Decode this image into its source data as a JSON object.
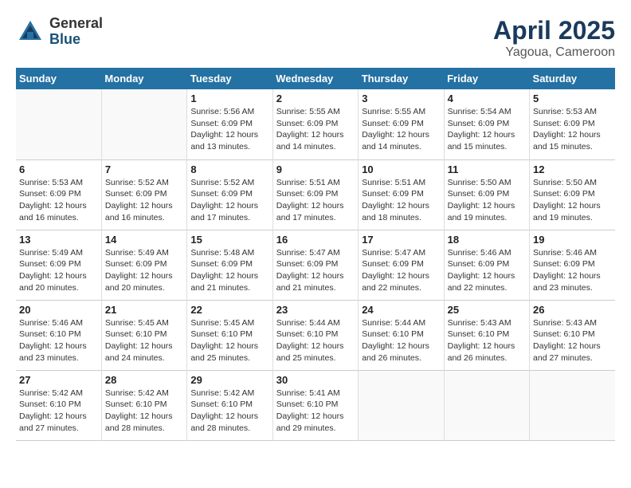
{
  "logo": {
    "general": "General",
    "blue": "Blue"
  },
  "title": "April 2025",
  "subtitle": "Yagoua, Cameroon",
  "header_days": [
    "Sunday",
    "Monday",
    "Tuesday",
    "Wednesday",
    "Thursday",
    "Friday",
    "Saturday"
  ],
  "weeks": [
    [
      {
        "day": "",
        "info": ""
      },
      {
        "day": "",
        "info": ""
      },
      {
        "day": "1",
        "info": "Sunrise: 5:56 AM\nSunset: 6:09 PM\nDaylight: 12 hours\nand 13 minutes."
      },
      {
        "day": "2",
        "info": "Sunrise: 5:55 AM\nSunset: 6:09 PM\nDaylight: 12 hours\nand 14 minutes."
      },
      {
        "day": "3",
        "info": "Sunrise: 5:55 AM\nSunset: 6:09 PM\nDaylight: 12 hours\nand 14 minutes."
      },
      {
        "day": "4",
        "info": "Sunrise: 5:54 AM\nSunset: 6:09 PM\nDaylight: 12 hours\nand 15 minutes."
      },
      {
        "day": "5",
        "info": "Sunrise: 5:53 AM\nSunset: 6:09 PM\nDaylight: 12 hours\nand 15 minutes."
      }
    ],
    [
      {
        "day": "6",
        "info": "Sunrise: 5:53 AM\nSunset: 6:09 PM\nDaylight: 12 hours\nand 16 minutes."
      },
      {
        "day": "7",
        "info": "Sunrise: 5:52 AM\nSunset: 6:09 PM\nDaylight: 12 hours\nand 16 minutes."
      },
      {
        "day": "8",
        "info": "Sunrise: 5:52 AM\nSunset: 6:09 PM\nDaylight: 12 hours\nand 17 minutes."
      },
      {
        "day": "9",
        "info": "Sunrise: 5:51 AM\nSunset: 6:09 PM\nDaylight: 12 hours\nand 17 minutes."
      },
      {
        "day": "10",
        "info": "Sunrise: 5:51 AM\nSunset: 6:09 PM\nDaylight: 12 hours\nand 18 minutes."
      },
      {
        "day": "11",
        "info": "Sunrise: 5:50 AM\nSunset: 6:09 PM\nDaylight: 12 hours\nand 19 minutes."
      },
      {
        "day": "12",
        "info": "Sunrise: 5:50 AM\nSunset: 6:09 PM\nDaylight: 12 hours\nand 19 minutes."
      }
    ],
    [
      {
        "day": "13",
        "info": "Sunrise: 5:49 AM\nSunset: 6:09 PM\nDaylight: 12 hours\nand 20 minutes."
      },
      {
        "day": "14",
        "info": "Sunrise: 5:49 AM\nSunset: 6:09 PM\nDaylight: 12 hours\nand 20 minutes."
      },
      {
        "day": "15",
        "info": "Sunrise: 5:48 AM\nSunset: 6:09 PM\nDaylight: 12 hours\nand 21 minutes."
      },
      {
        "day": "16",
        "info": "Sunrise: 5:47 AM\nSunset: 6:09 PM\nDaylight: 12 hours\nand 21 minutes."
      },
      {
        "day": "17",
        "info": "Sunrise: 5:47 AM\nSunset: 6:09 PM\nDaylight: 12 hours\nand 22 minutes."
      },
      {
        "day": "18",
        "info": "Sunrise: 5:46 AM\nSunset: 6:09 PM\nDaylight: 12 hours\nand 22 minutes."
      },
      {
        "day": "19",
        "info": "Sunrise: 5:46 AM\nSunset: 6:09 PM\nDaylight: 12 hours\nand 23 minutes."
      }
    ],
    [
      {
        "day": "20",
        "info": "Sunrise: 5:46 AM\nSunset: 6:10 PM\nDaylight: 12 hours\nand 23 minutes."
      },
      {
        "day": "21",
        "info": "Sunrise: 5:45 AM\nSunset: 6:10 PM\nDaylight: 12 hours\nand 24 minutes."
      },
      {
        "day": "22",
        "info": "Sunrise: 5:45 AM\nSunset: 6:10 PM\nDaylight: 12 hours\nand 25 minutes."
      },
      {
        "day": "23",
        "info": "Sunrise: 5:44 AM\nSunset: 6:10 PM\nDaylight: 12 hours\nand 25 minutes."
      },
      {
        "day": "24",
        "info": "Sunrise: 5:44 AM\nSunset: 6:10 PM\nDaylight: 12 hours\nand 26 minutes."
      },
      {
        "day": "25",
        "info": "Sunrise: 5:43 AM\nSunset: 6:10 PM\nDaylight: 12 hours\nand 26 minutes."
      },
      {
        "day": "26",
        "info": "Sunrise: 5:43 AM\nSunset: 6:10 PM\nDaylight: 12 hours\nand 27 minutes."
      }
    ],
    [
      {
        "day": "27",
        "info": "Sunrise: 5:42 AM\nSunset: 6:10 PM\nDaylight: 12 hours\nand 27 minutes."
      },
      {
        "day": "28",
        "info": "Sunrise: 5:42 AM\nSunset: 6:10 PM\nDaylight: 12 hours\nand 28 minutes."
      },
      {
        "day": "29",
        "info": "Sunrise: 5:42 AM\nSunset: 6:10 PM\nDaylight: 12 hours\nand 28 minutes."
      },
      {
        "day": "30",
        "info": "Sunrise: 5:41 AM\nSunset: 6:10 PM\nDaylight: 12 hours\nand 29 minutes."
      },
      {
        "day": "",
        "info": ""
      },
      {
        "day": "",
        "info": ""
      },
      {
        "day": "",
        "info": ""
      }
    ]
  ]
}
